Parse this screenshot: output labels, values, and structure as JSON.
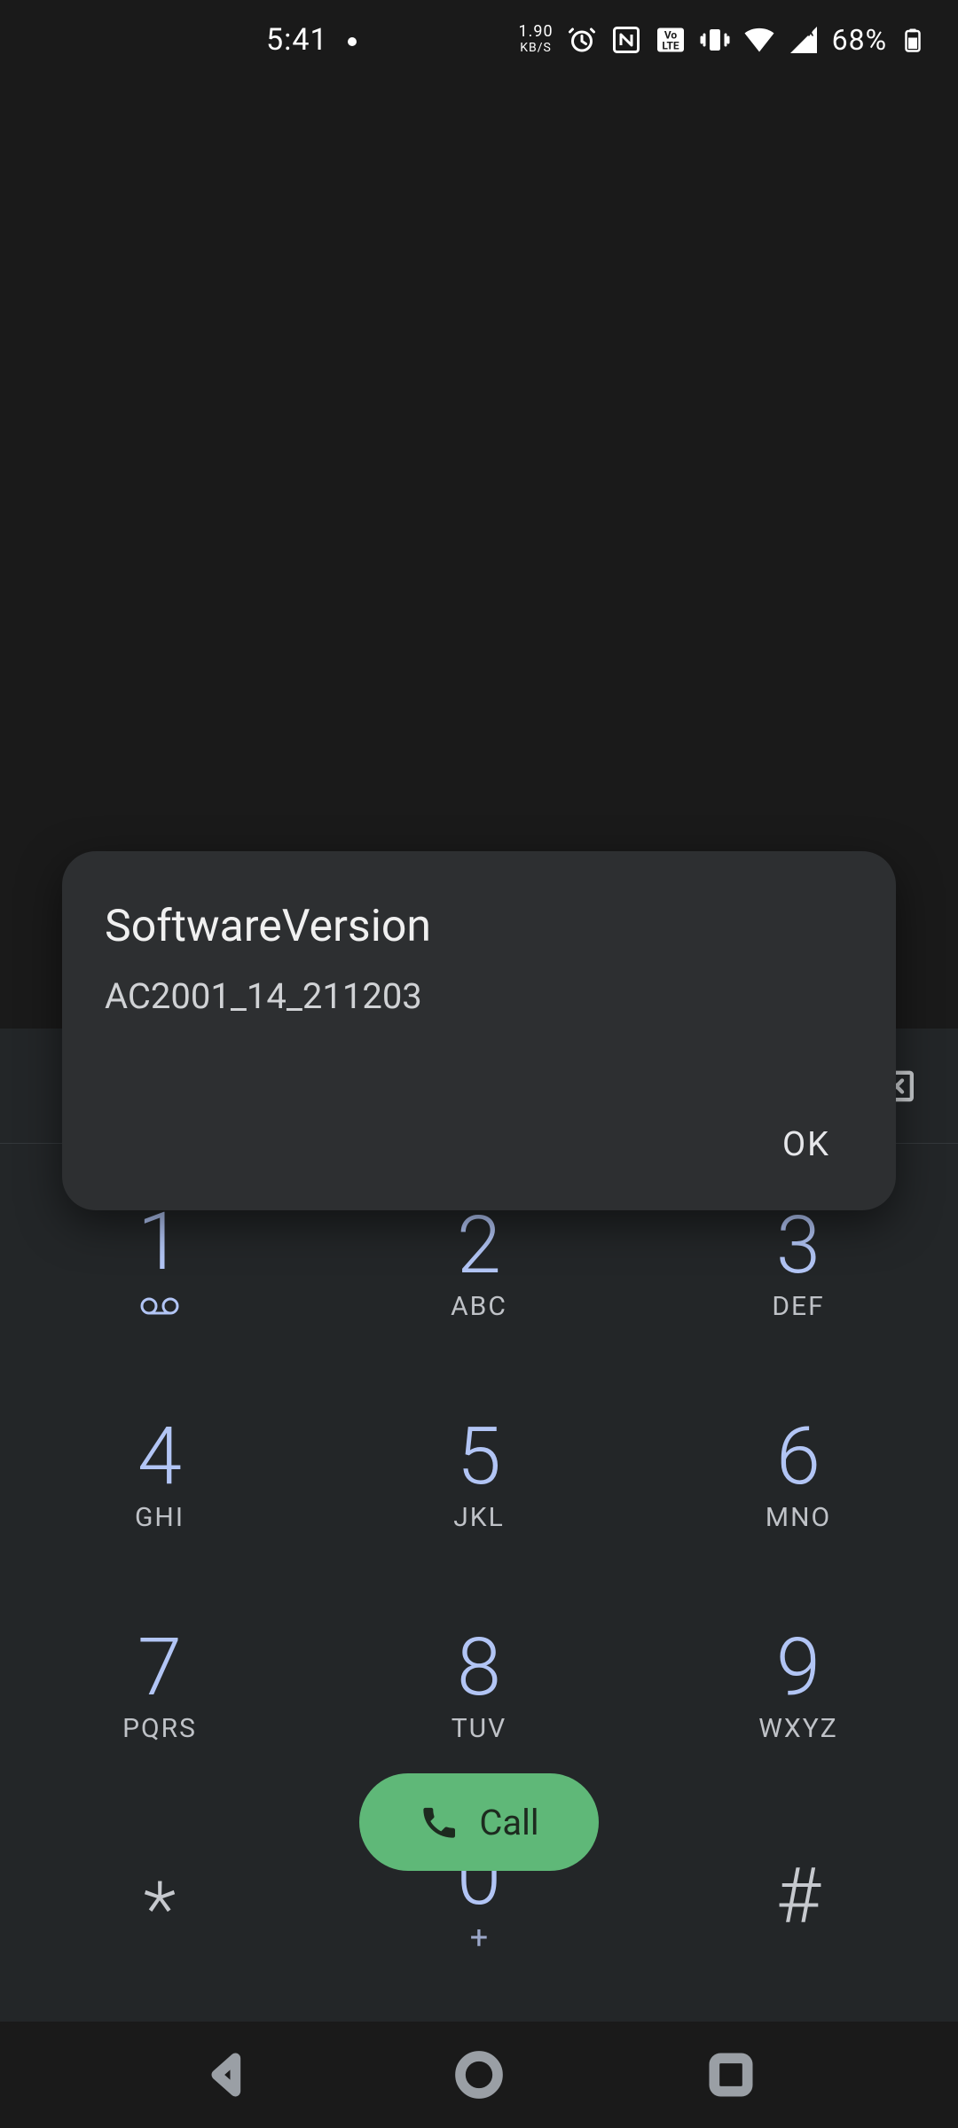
{
  "status": {
    "time": "5:41",
    "net_rate_l1": "1.90",
    "net_rate_l2": "KB/S",
    "battery_pct": "68%"
  },
  "dialog": {
    "title": "SoftwareVersion",
    "body": "AC2001_14_211203",
    "ok_label": "OK"
  },
  "keypad": {
    "k1": {
      "digit": "1",
      "letters": ""
    },
    "k2": {
      "digit": "2",
      "letters": "ABC"
    },
    "k3": {
      "digit": "3",
      "letters": "DEF"
    },
    "k4": {
      "digit": "4",
      "letters": "GHI"
    },
    "k5": {
      "digit": "5",
      "letters": "JKL"
    },
    "k6": {
      "digit": "6",
      "letters": "MNO"
    },
    "k7": {
      "digit": "7",
      "letters": "PQRS"
    },
    "k8": {
      "digit": "8",
      "letters": "TUV"
    },
    "k9": {
      "digit": "9",
      "letters": "WXYZ"
    },
    "kstar": {
      "digit": "*"
    },
    "k0": {
      "digit": "0",
      "letters": "+"
    },
    "khash": {
      "digit": "#"
    }
  },
  "call": {
    "label": "Call"
  }
}
